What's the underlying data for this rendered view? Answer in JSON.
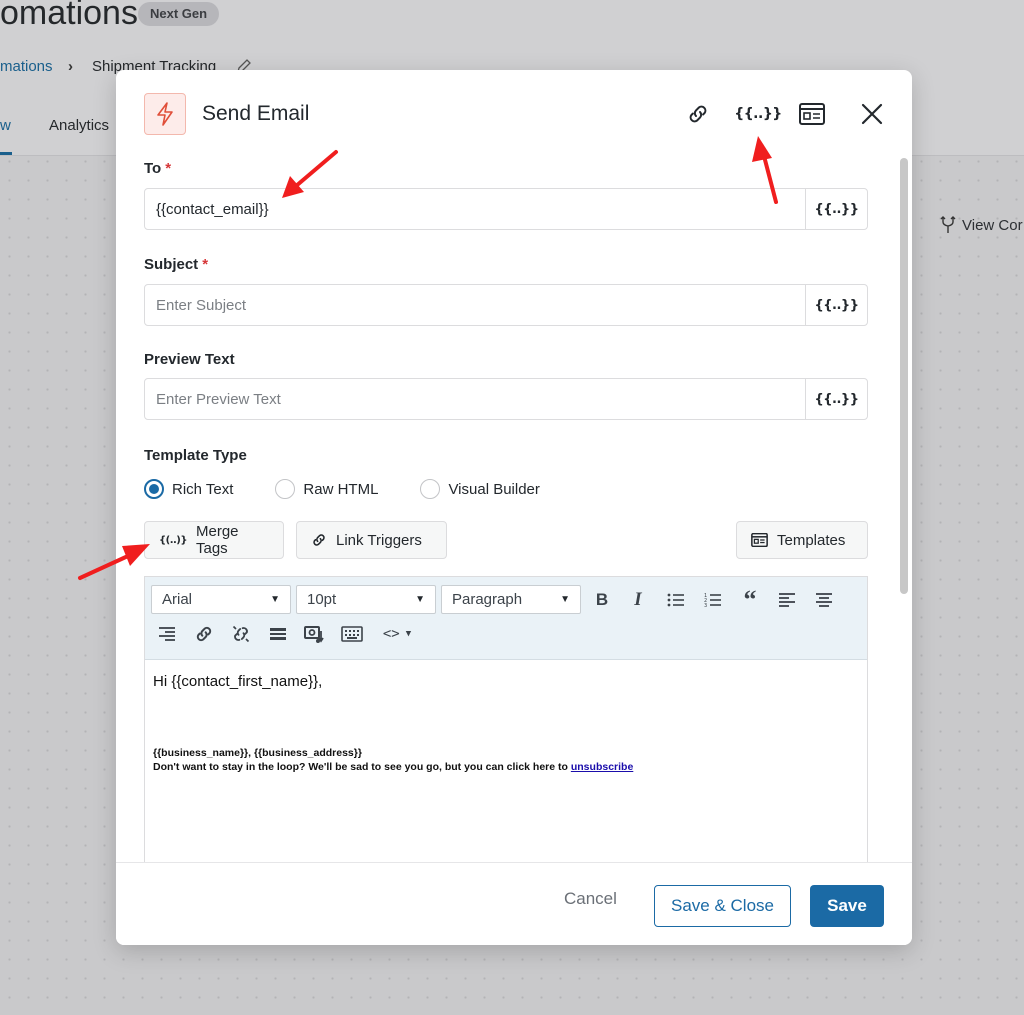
{
  "background": {
    "page_title": "omations",
    "badge": "Next Gen",
    "breadcrumb": {
      "parent": "mations",
      "separator": "›",
      "current": "Shipment Tracking"
    },
    "tabs": {
      "active": "w",
      "analytics": "Analytics"
    },
    "view_link": "View Cor"
  },
  "modal": {
    "title": "Send Email",
    "icons": {
      "action": "lightning-icon",
      "link": "link-icon",
      "merge_tags": "merge-tags-icon",
      "preview": "preview-icon",
      "close": "close-icon"
    },
    "merge_tag_glyph": "{{..}}",
    "fields": {
      "to": {
        "label": "To",
        "required": "*",
        "value": "{{contact_email}}"
      },
      "subject": {
        "label": "Subject",
        "required": "*",
        "placeholder": "Enter Subject"
      },
      "preview": {
        "label": "Preview Text",
        "placeholder": "Enter Preview Text"
      }
    },
    "template_type": {
      "label": "Template Type",
      "options": [
        "Rich Text",
        "Raw HTML",
        "Visual Builder"
      ],
      "selected": "Rich Text"
    },
    "tool_buttons": {
      "merge_tags": "Merge Tags",
      "link_triggers": "Link Triggers",
      "templates": "Templates"
    },
    "editor": {
      "font": "Arial",
      "size": "10pt",
      "block": "Paragraph",
      "content": {
        "greeting": "Hi {{contact_first_name}},",
        "footer_line1": "{{business_name}}, {{business_address}}",
        "footer_line2": "Don't want to stay in the loop? We'll be sad to see you go, but you can click here to",
        "unsubscribe": "unsubscribe"
      }
    },
    "footer": {
      "cancel": "Cancel",
      "save_close": "Save & Close",
      "save": "Save"
    }
  },
  "colors": {
    "primary": "#1b6aa5",
    "required": "#d63638",
    "annotation_arrow": "#f01e1e",
    "action_icon": "#e04e39"
  }
}
